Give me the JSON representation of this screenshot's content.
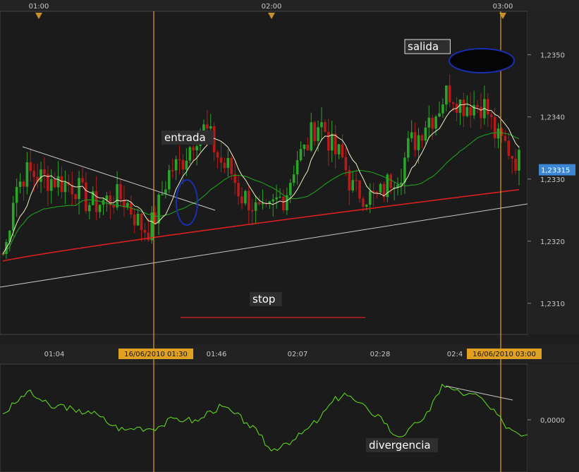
{
  "chart_data": [
    {
      "type": "candlestick",
      "top_time_labels": [
        "01:00",
        "02:00",
        "03:00"
      ],
      "bottom_time_labels": [
        "01:04",
        "01:46",
        "02:07",
        "02:28",
        "02:4"
      ],
      "vertical_markers": [
        {
          "label": "16/06/2010 01:30"
        },
        {
          "label": "16/06/2010 03:00"
        }
      ],
      "y_ticks": [
        "1,2350",
        "1,2340",
        "1,2330",
        "1,2320",
        "1,2310"
      ],
      "y_tick_values": [
        1.235,
        1.234,
        1.233,
        1.232,
        1.231
      ],
      "ylim": [
        1.2305,
        1.2357
      ],
      "current_price": "1,23315",
      "annotations": [
        "entrada",
        "salida",
        "stop"
      ],
      "colors": {
        "up": "#2aa52a",
        "down": "#b81a1a",
        "ma_fast": "#f2f0c4",
        "ma_mid": "#1f9e1f",
        "ma_slow": "#d92020",
        "trendline": "#c8c8c8",
        "marker": "#e0a020",
        "price_badge": "#3a87d6"
      }
    },
    {
      "type": "line",
      "series": [
        {
          "values": [
            0.2,
            0.55,
            0.95,
            0.7,
            0.4,
            0.5,
            0.25,
            0.3,
            0.1,
            -0.2,
            -0.35,
            -0.25,
            -0.3,
            -0.2,
            0.05,
            0.0,
            -0.05,
            0.3,
            0.45,
            0.2,
            -0.1,
            -0.5,
            -1.05,
            -0.8,
            -0.65,
            -0.3,
            0.05,
            0.6,
            0.9,
            0.6,
            0.3,
            0.1,
            -0.5,
            -0.5,
            -0.1,
            0.3,
            1.2,
            1.0,
            0.85,
            0.8,
            0.35,
            -0.1,
            -0.4,
            -0.5
          ]
        }
      ],
      "y_ticks": [
        "0,0000"
      ],
      "annotation": "divergencia"
    }
  ]
}
